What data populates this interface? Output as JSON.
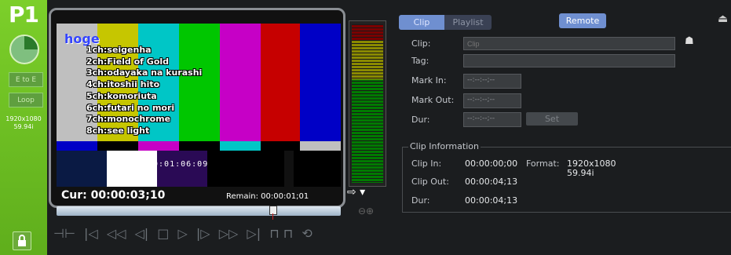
{
  "strip": {
    "title": "P1",
    "ee_label": "E to E",
    "loop_label": "Loop",
    "res_line1": "1920x1080",
    "res_line2": "59.94i"
  },
  "video": {
    "overlay_title": "hoge",
    "channels": [
      "1ch:seigenha",
      "2ch:Field of Gold",
      "3ch:odayaka na kurashi",
      "4ch:itoshii hito",
      "5ch:komoriuta",
      "6ch:futari no mori",
      "7ch:monochrome",
      "8ch:see light"
    ],
    "inset_timecode": "00:01:06:09",
    "cur_label": "Cur: 00:00:03;10",
    "remain_label": "Remain: 00:00:01;01"
  },
  "right": {
    "tab_clip": "Clip",
    "tab_playlist": "Playlist",
    "remote_label": "Remote",
    "clip_label": "Clip:",
    "clip_placeholder": "Clip",
    "tag_label": "Tag:",
    "mark_in_label": "Mark In:",
    "mark_in_value": "--:--:--;--",
    "mark_out_label": "Mark Out:",
    "mark_out_value": "--:--:--;--",
    "dur_label": "Dur:",
    "dur_value": "--:--:--;--",
    "set_label": "Set",
    "info_title": "Clip Information",
    "clip_in_label": "Clip In:",
    "clip_in_value": "00:00:00;00",
    "clip_out_label": "Clip Out:",
    "clip_out_value": "00:00:04;13",
    "dur2_label": "Dur:",
    "dur2_value": "00:00:04;13",
    "format_label": "Format:",
    "format_line1": "1920x1080",
    "format_line2": "59.94i"
  },
  "playback": {
    "position_fraction": 0.76
  },
  "colors": {
    "strip": "#6dbd24",
    "accent": "#6f8fd0"
  }
}
